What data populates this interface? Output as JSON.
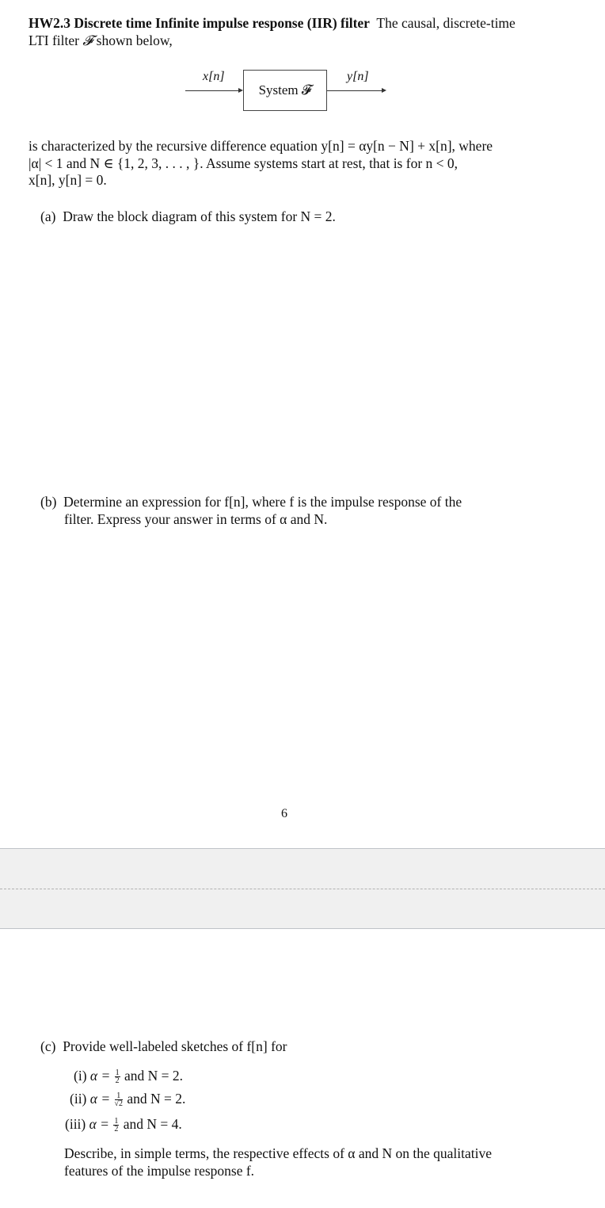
{
  "problem": {
    "title": "HW2.3 Discrete time Infinite impulse response (IIR) filter",
    "intro_line1": "The causal, discrete-time",
    "intro_line2_pre": "LTI filter ",
    "filter_symbol": "𝓕",
    "intro_line2_post": " shown below,"
  },
  "diagram": {
    "input_label": "x[n]",
    "box_label": "System 𝓕",
    "output_label": "y[n]"
  },
  "description": {
    "line1": "is characterized by the recursive difference equation y[n] = αy[n − N] + x[n], where",
    "line2": "|α| < 1 and N ∈ {1, 2, 3, . . . , }.  Assume systems start at rest, that is for n < 0,",
    "line3": "x[n], y[n] = 0."
  },
  "parts": {
    "a": {
      "label": "(a)",
      "text": "Draw the block diagram of this system for N = 2."
    },
    "b": {
      "label": "(b)",
      "line1": "Determine an expression for f[n], where f is the impulse response of the",
      "line2": "filter. Express your answer in terms of α and N."
    },
    "c": {
      "label": "(c)",
      "text": "Provide well-labeled sketches of f[n] for",
      "items": [
        {
          "label": "(i)",
          "alpha_prefix": "α =",
          "num": "1",
          "den": "2",
          "suffix": "and N = 2."
        },
        {
          "label": "(ii)",
          "alpha_prefix": "α =",
          "num": "1",
          "den": "√2",
          "suffix": "and N = 2."
        },
        {
          "label": "(iii)",
          "alpha_prefix": "α =",
          "num": "1",
          "den": "2",
          "suffix": "and N = 4."
        }
      ],
      "describe_line1": "Describe, in simple terms, the respective effects of α and N on the qualitative",
      "describe_line2": "features of the impulse response f."
    }
  },
  "page_number": "6"
}
